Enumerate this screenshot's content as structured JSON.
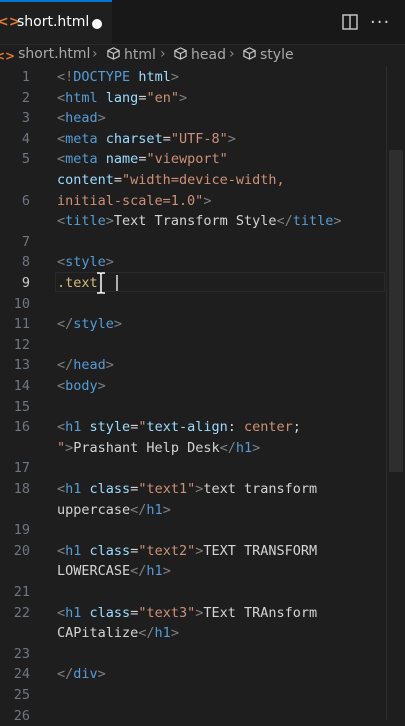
{
  "tab": {
    "icon": "<>",
    "title": "short.html",
    "dirty": true
  },
  "breadcrumb": [
    {
      "label": "short.html",
      "icon": "html-file-icon"
    },
    {
      "label": "html",
      "icon": "symbol-element-icon"
    },
    {
      "label": "head",
      "icon": "symbol-element-icon"
    },
    {
      "label": "style",
      "icon": "symbol-element-icon"
    }
  ],
  "editor": {
    "active_line": 9,
    "line_numbers": [
      "1",
      "2",
      "3",
      "4",
      "5",
      "",
      "6",
      "",
      "7",
      "8",
      "9",
      "10",
      "11",
      "12",
      "13",
      "14",
      "15",
      "16",
      "",
      "17",
      "18",
      "",
      "19",
      "20",
      "",
      "21",
      "22",
      "",
      "23",
      "24",
      "25",
      "26"
    ],
    "lines": [
      {
        "parts": [
          {
            "c": "t-br",
            "t": "<!"
          },
          {
            "c": "t-tag",
            "t": "DOCTYPE"
          },
          {
            "c": "t-txt",
            "t": " "
          },
          {
            "c": "t-attr",
            "t": "html"
          },
          {
            "c": "t-br",
            "t": ">"
          }
        ]
      },
      {
        "parts": [
          {
            "c": "t-br",
            "t": "<"
          },
          {
            "c": "t-tag",
            "t": "html"
          },
          {
            "c": "t-txt",
            "t": " "
          },
          {
            "c": "t-attr",
            "t": "lang"
          },
          {
            "c": "t-txt",
            "t": "="
          },
          {
            "c": "t-str",
            "t": "\"en\""
          },
          {
            "c": "t-br",
            "t": ">"
          }
        ]
      },
      {
        "parts": [
          {
            "c": "t-br",
            "t": "<"
          },
          {
            "c": "t-tag",
            "t": "head"
          },
          {
            "c": "t-br",
            "t": ">"
          }
        ]
      },
      {
        "parts": [
          {
            "c": "t-br",
            "t": "<"
          },
          {
            "c": "t-tag",
            "t": "meta"
          },
          {
            "c": "t-txt",
            "t": " "
          },
          {
            "c": "t-attr",
            "t": "charset"
          },
          {
            "c": "t-txt",
            "t": "="
          },
          {
            "c": "t-str",
            "t": "\"UTF-8\""
          },
          {
            "c": "t-br",
            "t": ">"
          }
        ]
      },
      {
        "parts": [
          {
            "c": "t-br",
            "t": "<"
          },
          {
            "c": "t-tag",
            "t": "meta"
          },
          {
            "c": "t-txt",
            "t": " "
          },
          {
            "c": "t-attr",
            "t": "name"
          },
          {
            "c": "t-txt",
            "t": "="
          },
          {
            "c": "t-str",
            "t": "\"viewport\""
          }
        ]
      },
      {
        "parts": [
          {
            "c": "t-attr",
            "t": "content"
          },
          {
            "c": "t-txt",
            "t": "="
          },
          {
            "c": "t-str",
            "t": "\"width=device-width,"
          }
        ]
      },
      {
        "parts": [
          {
            "c": "t-str",
            "t": "initial-scale=1.0\""
          },
          {
            "c": "t-br",
            "t": ">"
          }
        ]
      },
      {
        "parts": [
          {
            "c": "t-br",
            "t": "<"
          },
          {
            "c": "t-tag",
            "t": "title"
          },
          {
            "c": "t-br",
            "t": ">"
          },
          {
            "c": "t-txt",
            "t": "Text Transform Style"
          },
          {
            "c": "t-br",
            "t": "</"
          },
          {
            "c": "t-tag",
            "t": "title"
          },
          {
            "c": "t-br",
            "t": ">"
          }
        ]
      },
      {
        "parts": []
      },
      {
        "parts": [
          {
            "c": "t-br",
            "t": "<"
          },
          {
            "c": "t-tag",
            "t": "style"
          },
          {
            "c": "t-br",
            "t": ">"
          }
        ]
      },
      {
        "parts": [
          {
            "c": "t-sel",
            "t": ".text"
          }
        ]
      },
      {
        "parts": []
      },
      {
        "parts": [
          {
            "c": "t-br",
            "t": "</"
          },
          {
            "c": "t-tag",
            "t": "style"
          },
          {
            "c": "t-br",
            "t": ">"
          }
        ]
      },
      {
        "parts": []
      },
      {
        "parts": [
          {
            "c": "t-br",
            "t": "</"
          },
          {
            "c": "t-tag",
            "t": "head"
          },
          {
            "c": "t-br",
            "t": ">"
          }
        ]
      },
      {
        "parts": [
          {
            "c": "t-br",
            "t": "<"
          },
          {
            "c": "t-tag",
            "t": "body"
          },
          {
            "c": "t-br",
            "t": ">"
          }
        ]
      },
      {
        "parts": []
      },
      {
        "parts": [
          {
            "c": "t-br",
            "t": "<"
          },
          {
            "c": "t-tag",
            "t": "h1"
          },
          {
            "c": "t-txt",
            "t": " "
          },
          {
            "c": "t-attr",
            "t": "style"
          },
          {
            "c": "t-txt",
            "t": "="
          },
          {
            "c": "t-str",
            "t": "\""
          },
          {
            "c": "t-attr",
            "t": "text-align"
          },
          {
            "c": "t-txt",
            "t": ": "
          },
          {
            "c": "t-str",
            "t": "center"
          },
          {
            "c": "t-txt",
            "t": ";"
          }
        ]
      },
      {
        "parts": [
          {
            "c": "t-str",
            "t": "\""
          },
          {
            "c": "t-br",
            "t": ">"
          },
          {
            "c": "t-txt",
            "t": "Prashant Help Desk"
          },
          {
            "c": "t-br",
            "t": "</"
          },
          {
            "c": "t-tag",
            "t": "h1"
          },
          {
            "c": "t-br",
            "t": ">"
          }
        ]
      },
      {
        "parts": []
      },
      {
        "parts": [
          {
            "c": "t-br",
            "t": "<"
          },
          {
            "c": "t-tag",
            "t": "h1"
          },
          {
            "c": "t-txt",
            "t": " "
          },
          {
            "c": "t-attr",
            "t": "class"
          },
          {
            "c": "t-txt",
            "t": "="
          },
          {
            "c": "t-str",
            "t": "\"text1\""
          },
          {
            "c": "t-br",
            "t": ">"
          },
          {
            "c": "t-txt",
            "t": "text transform"
          }
        ]
      },
      {
        "parts": [
          {
            "c": "t-txt",
            "t": "uppercase"
          },
          {
            "c": "t-br",
            "t": "</"
          },
          {
            "c": "t-tag",
            "t": "h1"
          },
          {
            "c": "t-br",
            "t": ">"
          }
        ]
      },
      {
        "parts": []
      },
      {
        "parts": [
          {
            "c": "t-br",
            "t": "<"
          },
          {
            "c": "t-tag",
            "t": "h1"
          },
          {
            "c": "t-txt",
            "t": " "
          },
          {
            "c": "t-attr",
            "t": "class"
          },
          {
            "c": "t-txt",
            "t": "="
          },
          {
            "c": "t-str",
            "t": "\"text2\""
          },
          {
            "c": "t-br",
            "t": ">"
          },
          {
            "c": "t-txt",
            "t": "TEXT TRANSFORM"
          }
        ]
      },
      {
        "parts": [
          {
            "c": "t-txt",
            "t": "LOWERCASE"
          },
          {
            "c": "t-br",
            "t": "</"
          },
          {
            "c": "t-tag",
            "t": "h1"
          },
          {
            "c": "t-br",
            "t": ">"
          }
        ]
      },
      {
        "parts": []
      },
      {
        "parts": [
          {
            "c": "t-br",
            "t": "<"
          },
          {
            "c": "t-tag",
            "t": "h1"
          },
          {
            "c": "t-txt",
            "t": " "
          },
          {
            "c": "t-attr",
            "t": "class"
          },
          {
            "c": "t-txt",
            "t": "="
          },
          {
            "c": "t-str",
            "t": "\"text3\""
          },
          {
            "c": "t-br",
            "t": ">"
          },
          {
            "c": "t-txt",
            "t": "TExt TRAnsform"
          }
        ]
      },
      {
        "parts": [
          {
            "c": "t-txt",
            "t": "CAPitalize"
          },
          {
            "c": "t-br",
            "t": "</"
          },
          {
            "c": "t-tag",
            "t": "h1"
          },
          {
            "c": "t-br",
            "t": ">"
          }
        ]
      },
      {
        "parts": []
      },
      {
        "parts": [
          {
            "c": "t-br",
            "t": "</"
          },
          {
            "c": "t-tag",
            "t": "div"
          },
          {
            "c": "t-br",
            "t": ">"
          }
        ]
      },
      {
        "parts": []
      },
      {
        "parts": []
      }
    ]
  }
}
